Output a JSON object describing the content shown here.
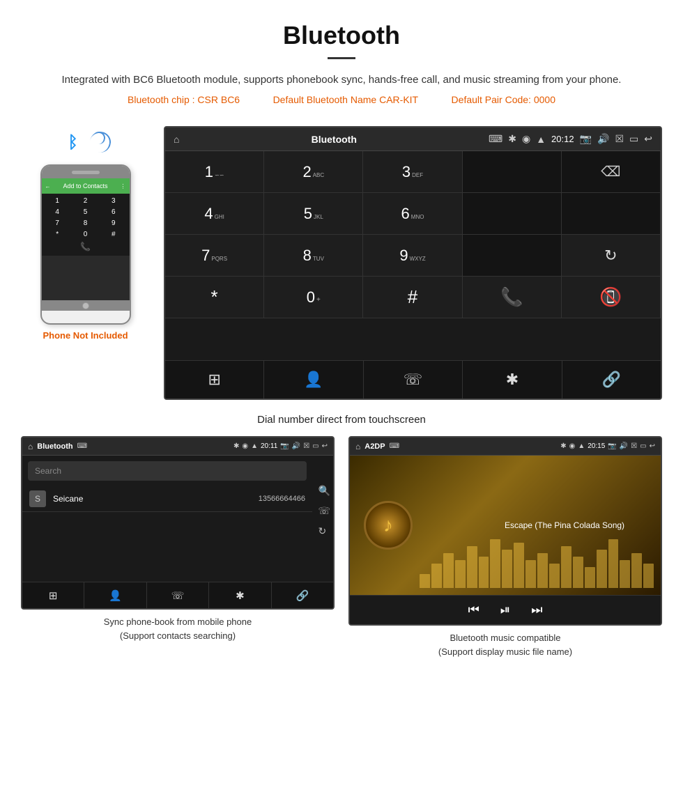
{
  "header": {
    "title": "Bluetooth",
    "description": "Integrated with BC6 Bluetooth module, supports phonebook sync, hands-free call, and music streaming from your phone.",
    "specs": {
      "chip": "Bluetooth chip : CSR BC6",
      "name": "Default Bluetooth Name CAR-KIT",
      "pair": "Default Pair Code: 0000"
    }
  },
  "phone_label": "Phone Not Included",
  "main_screen": {
    "title": "Bluetooth",
    "time": "20:12",
    "usb_icon": "⌨",
    "dialpad": {
      "keys": [
        {
          "num": "1",
          "sub": "∽∽"
        },
        {
          "num": "2",
          "sub": "ABC"
        },
        {
          "num": "3",
          "sub": "DEF"
        },
        {
          "num": "4",
          "sub": "GHI"
        },
        {
          "num": "5",
          "sub": "JKL"
        },
        {
          "num": "6",
          "sub": "MNO"
        },
        {
          "num": "7",
          "sub": "PQRS"
        },
        {
          "num": "8",
          "sub": "TUV"
        },
        {
          "num": "9",
          "sub": "WXYZ"
        },
        {
          "num": "*",
          "sub": ""
        },
        {
          "num": "0",
          "sub": "+"
        },
        {
          "num": "#",
          "sub": ""
        }
      ]
    }
  },
  "caption_main": "Dial number direct from touchscreen",
  "phonebook_screen": {
    "title": "Bluetooth",
    "time": "20:11",
    "search_placeholder": "Search",
    "contacts": [
      {
        "initial": "S",
        "name": "Seicane",
        "number": "13566664466"
      }
    ]
  },
  "caption_phonebook_line1": "Sync phone-book from mobile phone",
  "caption_phonebook_line2": "(Support contacts searching)",
  "music_screen": {
    "title": "A2DP",
    "time": "20:15",
    "song_title": "Escape (The Pina Colada Song)",
    "eq_bars": [
      20,
      35,
      50,
      40,
      60,
      45,
      70,
      55,
      65,
      40,
      50,
      35,
      60,
      45,
      30,
      55,
      70,
      40,
      50,
      35
    ]
  },
  "caption_music_line1": "Bluetooth music compatible",
  "caption_music_line2": "(Support display music file name)",
  "icons": {
    "home": "⌂",
    "back": "↩",
    "bluetooth": "✱",
    "location": "◉",
    "signal": "▲",
    "camera": "📷",
    "volume": "🔊",
    "close_box": "☒",
    "window": "▭",
    "usb": "⑂",
    "backspace": "⌫",
    "refresh": "↻",
    "call_green": "📞",
    "call_red": "📵",
    "dialpad_grid": "⊞",
    "person": "👤",
    "phone": "☏",
    "bt": "⚡",
    "link": "🔗",
    "search": "🔍",
    "prev": "⏮",
    "play_pause": "⏯",
    "next": "⏭"
  }
}
